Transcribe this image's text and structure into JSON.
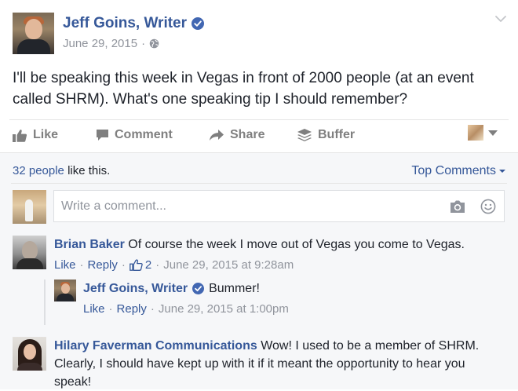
{
  "post": {
    "author": "Jeff Goins, Writer",
    "date": "June 29, 2015",
    "separator": "·",
    "text": "I'll be speaking this week in Vegas in front of 2000 people (at an event called SHRM). What's one speaking tip I should remember?"
  },
  "actions": {
    "like": "Like",
    "comment": "Comment",
    "share": "Share",
    "buffer": "Buffer"
  },
  "likes": {
    "count_link": "32 people",
    "suffix": " like this."
  },
  "top_comments": "Top Comments",
  "write_comment": {
    "placeholder": "Write a comment..."
  },
  "comments": [
    {
      "name": "Brian Baker",
      "text": "Of course the week I move out of Vegas you come to Vegas.",
      "like": "Like",
      "reply": "Reply",
      "likes_count": "2",
      "time": "June 29, 2015 at 9:28am"
    },
    {
      "name": "Jeff Goins, Writer",
      "text": "Bummer!",
      "like": "Like",
      "reply": "Reply",
      "time": "June 29, 2015 at 1:00pm"
    },
    {
      "name": "Hilary Faverman Communications",
      "text": "Wow! I used to be a member of SHRM. Clearly, I should have kept up with it if it meant the opportunity to hear you speak!"
    }
  ],
  "colors": {
    "link": "#365899",
    "meta": "#90949c",
    "action": "#7f7f7f",
    "verified": "#4267b2",
    "comments_bg": "#f6f7f9"
  }
}
